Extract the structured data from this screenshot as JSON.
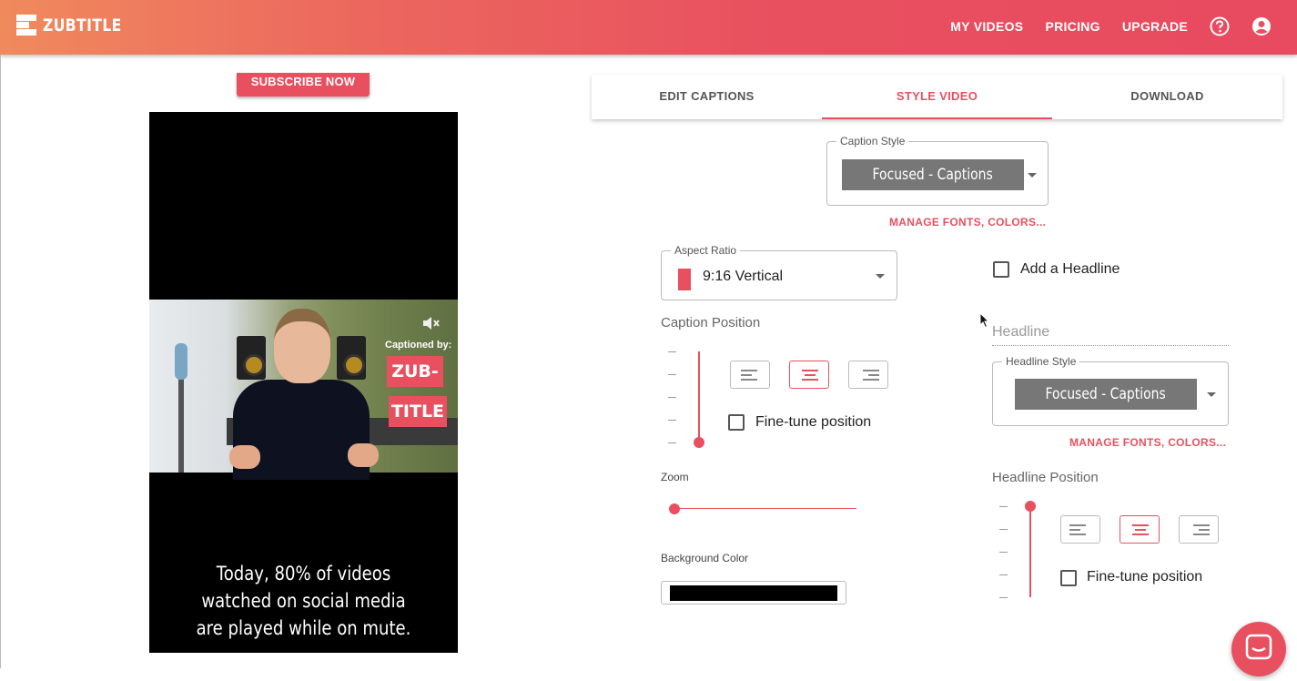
{
  "brand": {
    "name": "ZUBTITLE",
    "accent": "#e8505f"
  },
  "nav": {
    "my_videos": "MY VIDEOS",
    "pricing": "PRICING",
    "upgrade": "UPGRADE"
  },
  "preview": {
    "subscribe_label": "SUBSCRIBE NOW",
    "badge_captioned_by": "Captioned by:",
    "badge_line1": "ZUB-",
    "badge_line2": "TITLE",
    "caption_lines": [
      "Today, 80% of videos",
      "watched on social media",
      "are played while on mute."
    ]
  },
  "tabs": [
    {
      "label": "EDIT CAPTIONS",
      "active": false
    },
    {
      "label": "STYLE VIDEO",
      "active": true
    },
    {
      "label": "DOWNLOAD",
      "active": false
    }
  ],
  "caption_style": {
    "legend": "Caption Style",
    "value": "Focused - Captions",
    "manage_link": "MANAGE FONTS, COLORS..."
  },
  "aspect_ratio": {
    "legend": "Aspect Ratio",
    "value": "9:16 Vertical"
  },
  "caption_position": {
    "label": "Caption Position",
    "fine_tune_label": "Fine-tune position",
    "fine_tune_checked": false,
    "selected_alignment": "center"
  },
  "zoom": {
    "label": "Zoom",
    "value": 0
  },
  "background_color": {
    "label": "Background Color",
    "value": "#000000"
  },
  "headline": {
    "add_label": "Add a Headline",
    "checked": false,
    "placeholder": "Headline",
    "style_legend": "Headline Style",
    "style_value": "Focused - Captions",
    "manage_link": "MANAGE FONTS, COLORS...",
    "position_label": "Headline Position",
    "fine_tune_label": "Fine-tune position",
    "selected_alignment": "center"
  },
  "icons": {
    "help": "help-circle-icon",
    "account": "account-circle-icon",
    "mute": "volume-mute-icon",
    "chat": "chat-icon"
  }
}
